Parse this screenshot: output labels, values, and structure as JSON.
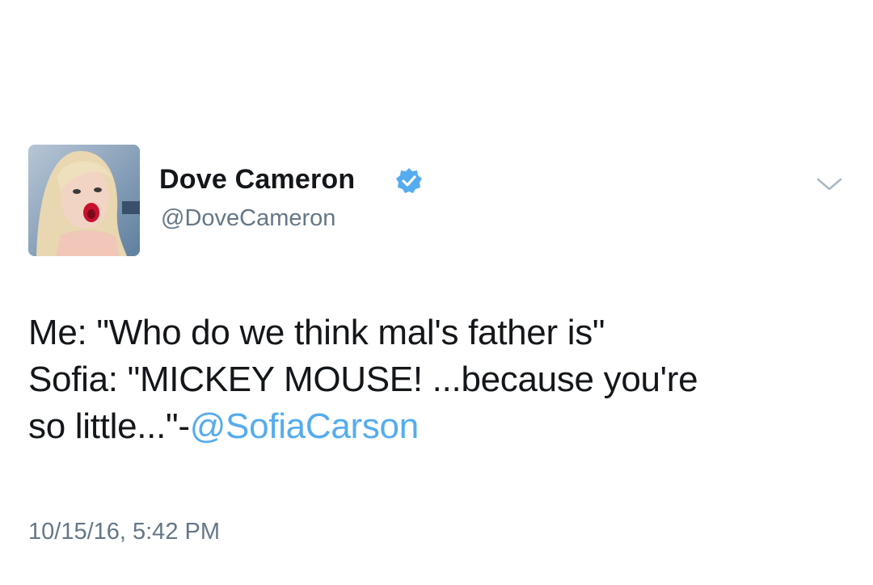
{
  "author": {
    "display_name": "Dove Cameron",
    "handle": "@DoveCameron",
    "verified": true,
    "avatar_icon": "profile-photo"
  },
  "tweet": {
    "line1": "Me: \"Who do we think mal's father is\"",
    "line2": "Sofia: \"MICKEY MOUSE! ...because you're",
    "line3_prefix": "so little...\"-",
    "mention": "@SofiaCarson"
  },
  "timestamp": "10/15/16, 5:42 PM",
  "icons": {
    "verified": "verified-badge-icon",
    "menu": "chevron-down-icon"
  },
  "colors": {
    "text": "#14171a",
    "secondary": "#657786",
    "link": "#55acee",
    "verified": "#55acee"
  }
}
